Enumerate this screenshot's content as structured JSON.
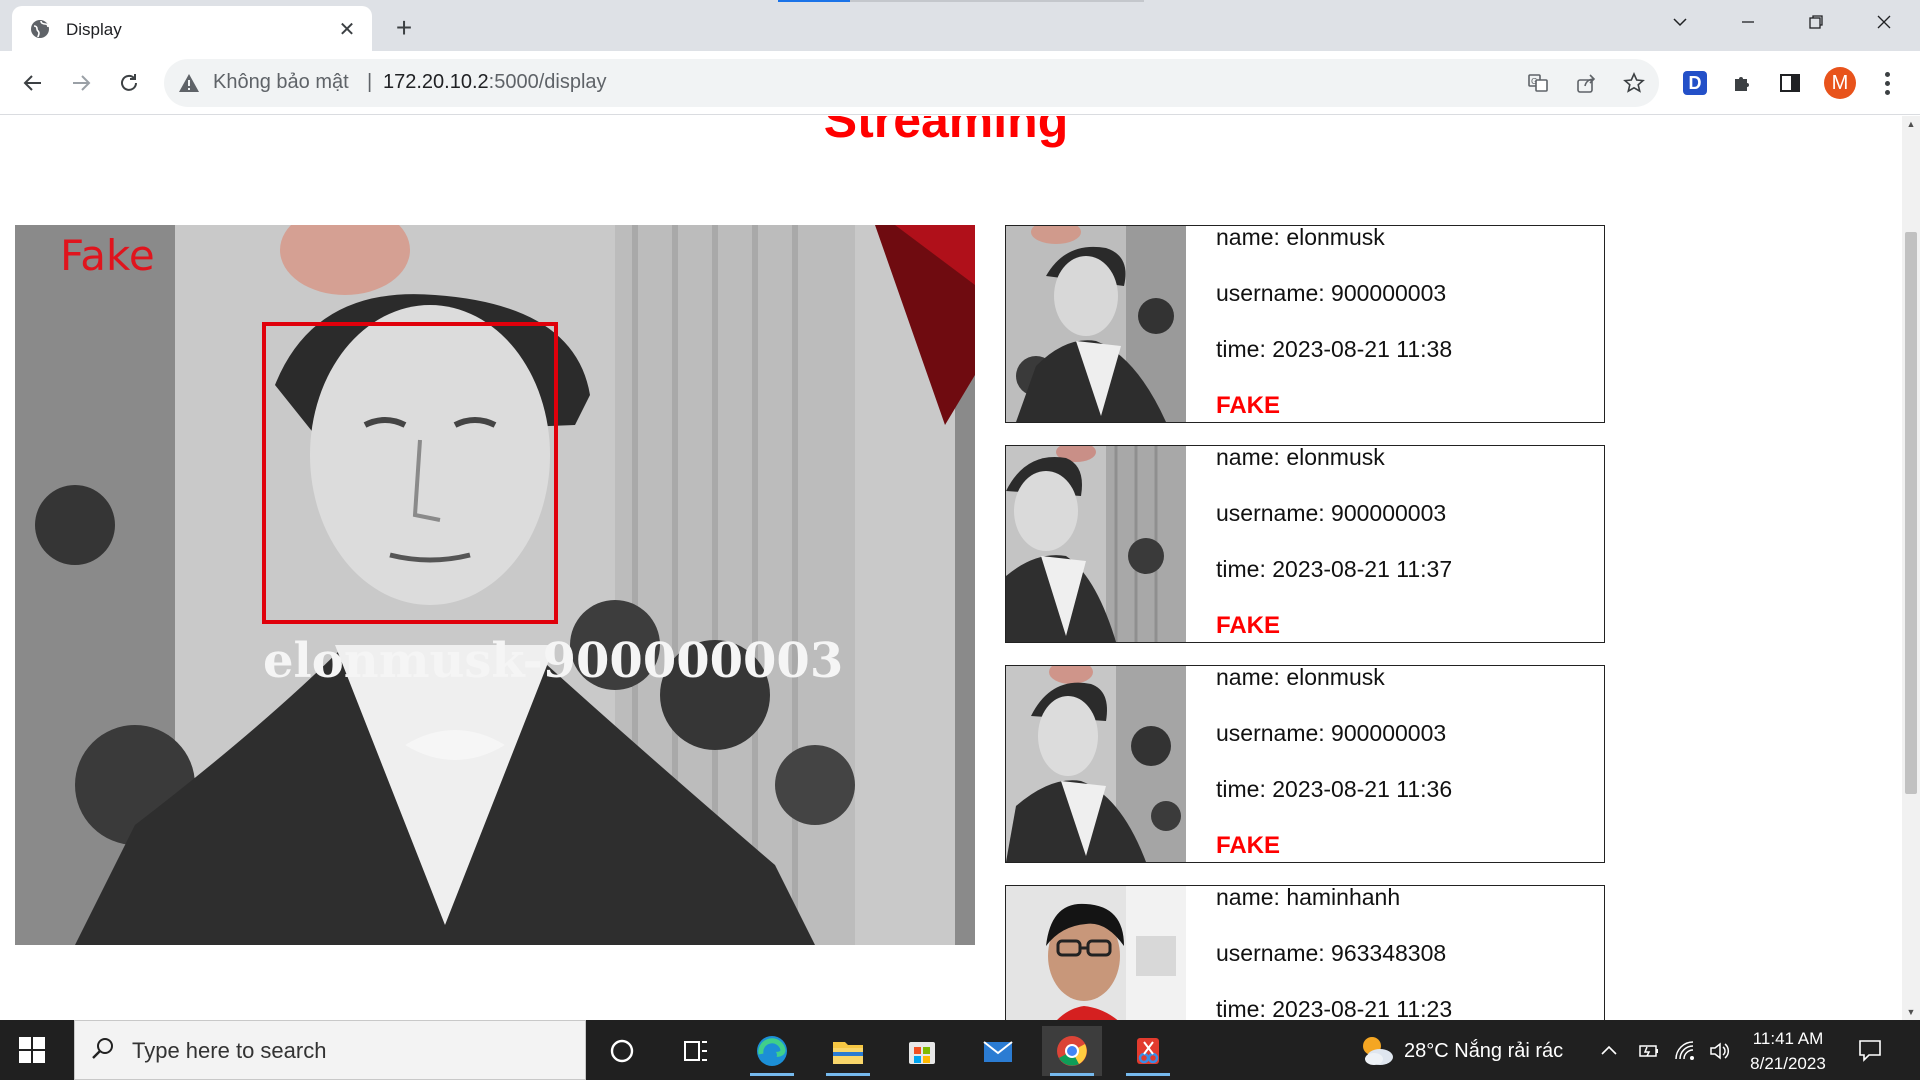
{
  "browser": {
    "tab_title": "Display",
    "security_label": "Không bảo mật",
    "url_host": "172.20.10.2",
    "url_rest": ":5000/display",
    "profile_initial": "M",
    "extension_label": "D"
  },
  "page": {
    "title": "Streaming",
    "stream": {
      "status_label": "Fake",
      "identity_label": "elonmusk-900000003"
    },
    "records": [
      {
        "name": "name: elonmusk",
        "username": "username: 900000003",
        "time": "time: 2023-08-21 11:38",
        "status": "FAKE"
      },
      {
        "name": "name: elonmusk",
        "username": "username: 900000003",
        "time": "time: 2023-08-21 11:37",
        "status": "FAKE"
      },
      {
        "name": "name: elonmusk",
        "username": "username: 900000003",
        "time": "time: 2023-08-21 11:36",
        "status": "FAKE"
      },
      {
        "name": "name: haminhanh",
        "username": "username: 963348308",
        "time": "time: 2023-08-21 11:23",
        "status": ""
      }
    ]
  },
  "taskbar": {
    "search_placeholder": "Type here to search",
    "weather": "28°C  Nắng rải rác",
    "time": "11:41 AM",
    "date": "8/21/2023"
  },
  "colors": {
    "accent_red": "#ff0000",
    "taskbar_bg": "#202020",
    "chrome_bg": "#dee1e6"
  }
}
